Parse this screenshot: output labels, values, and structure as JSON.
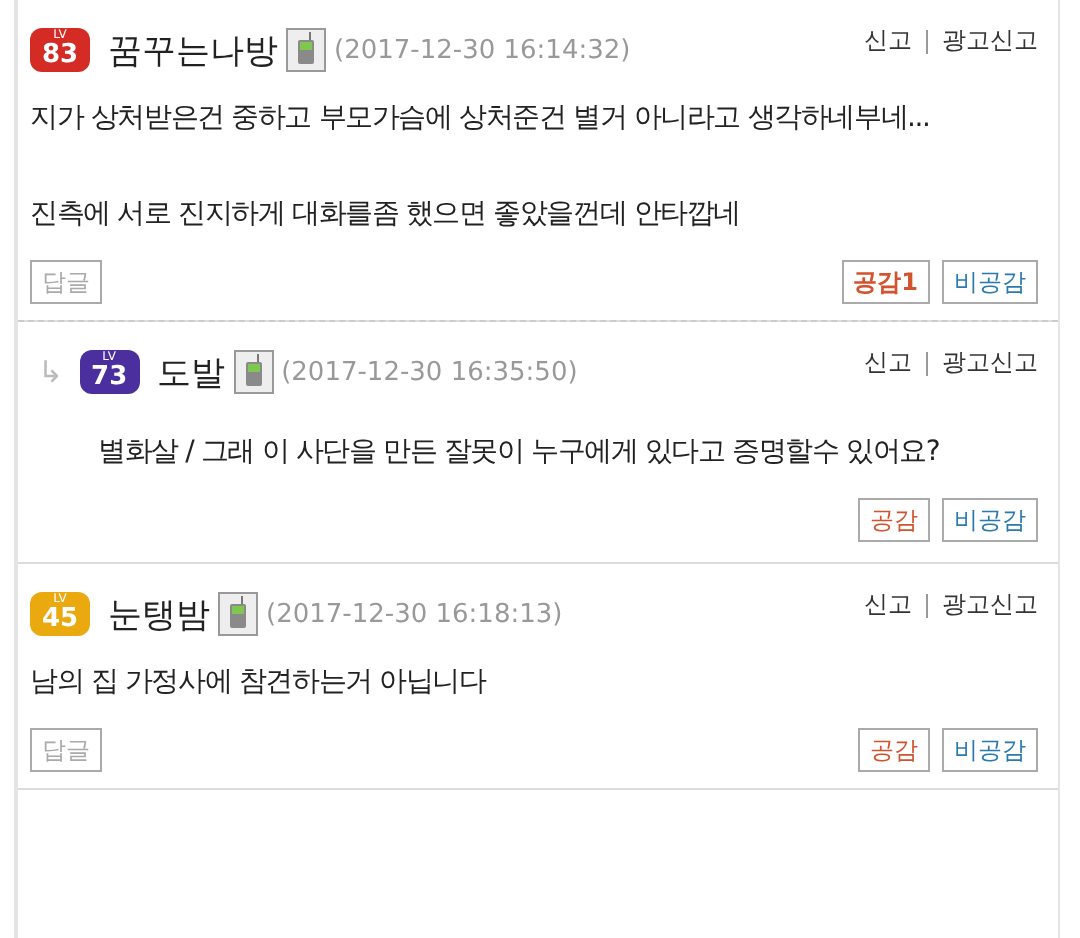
{
  "comments": [
    {
      "kind": "comment",
      "level_caption": "LV",
      "level": "83",
      "color": "#d42b25",
      "name": "꿈꾸는나방",
      "date": "(2017-12-30 16:14:32)",
      "report": "신고",
      "ad_report": "광고신고",
      "paragraphs": [
        "지가 상처받은건 중하고 부모가슴에 상처준건 별거 아니라고 생각하네부네...",
        "진측에 서로 진지하게 대화를좀 했으면 좋았을껀데 안타깝네"
      ],
      "reply_button": "답글",
      "like": "공감1",
      "dislike": "비공감"
    },
    {
      "kind": "reply",
      "arrow": "↳",
      "level_caption": "LV",
      "level": "73",
      "color": "#4b2f9e",
      "name": "도발",
      "date": "(2017-12-30 16:35:50)",
      "report": "신고",
      "ad_report": "광고신고",
      "paragraphs": [
        "별화살 / 그래 이 사단을 만든 잘못이 누구에게 있다고 증명할수 있어요?"
      ],
      "like": "공감",
      "dislike": "비공감"
    },
    {
      "kind": "comment",
      "level_caption": "LV",
      "level": "45",
      "color": "#e9a90f",
      "name": "눈탱밤",
      "date": "(2017-12-30 16:18:13)",
      "report": "신고",
      "ad_report": "광고신고",
      "paragraphs": [
        "남의 집 가정사에 참견하는거 아닙니다"
      ],
      "reply_button": "답글",
      "like": "공감",
      "dislike": "비공감"
    }
  ]
}
